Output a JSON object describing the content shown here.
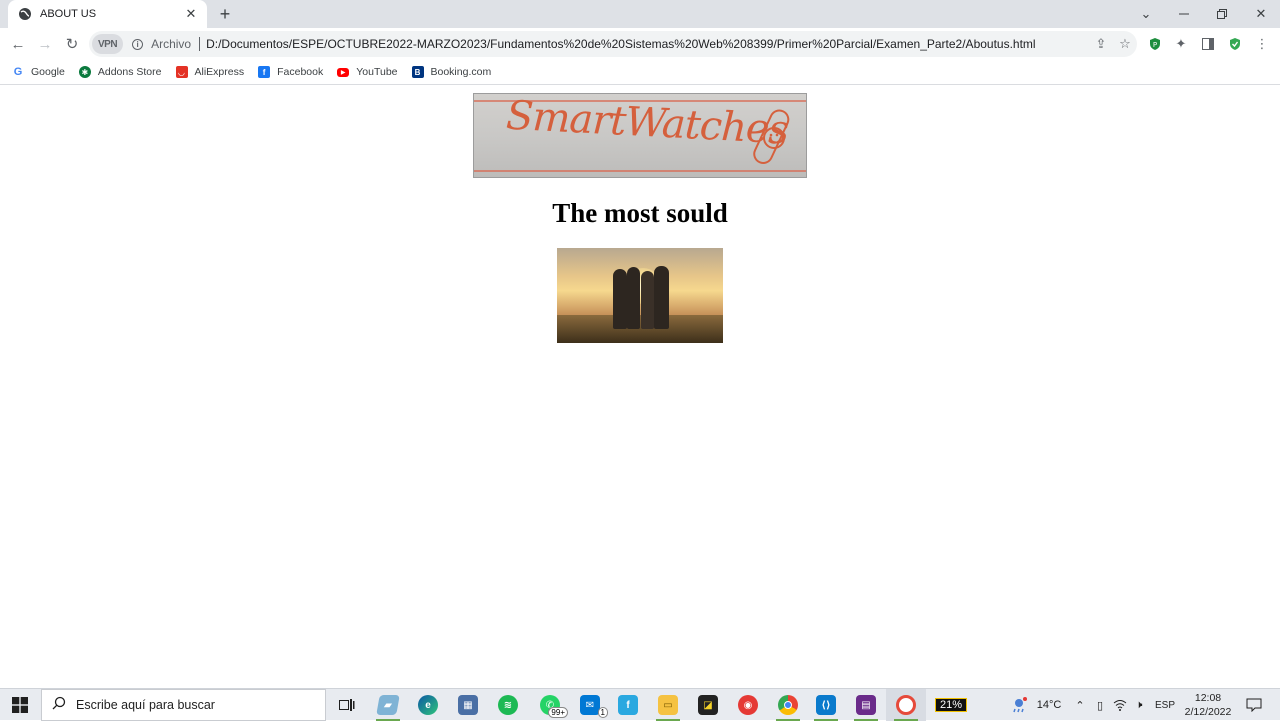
{
  "browser": {
    "tab": {
      "title": "ABOUT US"
    },
    "omnibox": {
      "vpn_label": "VPN",
      "scheme_label": "Archivo",
      "url": "D:/Documentos/ESPE/OCTUBRE2022-MARZO2023/Fundamentos%20de%20Sistemas%20Web%208399/Primer%20Parcial/Examen_Parte2/Aboutus.html"
    },
    "bookmarks": [
      {
        "label": "Google",
        "icon": "google-icon",
        "color": "#4285f4"
      },
      {
        "label": "Addons Store",
        "icon": "addons-store-icon",
        "color": "#0b7a3e"
      },
      {
        "label": "AliExpress",
        "icon": "aliexpress-icon",
        "color": "#e43225"
      },
      {
        "label": "Facebook",
        "icon": "facebook-icon",
        "color": "#1877f2"
      },
      {
        "label": "YouTube",
        "icon": "youtube-icon",
        "color": "#ff0000"
      },
      {
        "label": "Booking.com",
        "icon": "booking-icon",
        "color": "#003580"
      }
    ]
  },
  "page": {
    "banner_text": "SmartWatches",
    "heading": "The most sould"
  },
  "taskbar": {
    "search_placeholder": "Escribe aquí para buscar",
    "whatsapp_badge": "99+",
    "mail_badge": "1",
    "battery": "21%",
    "temperature": "14°C",
    "language": "ESP",
    "time": "12:08",
    "date": "2/12/2022"
  }
}
